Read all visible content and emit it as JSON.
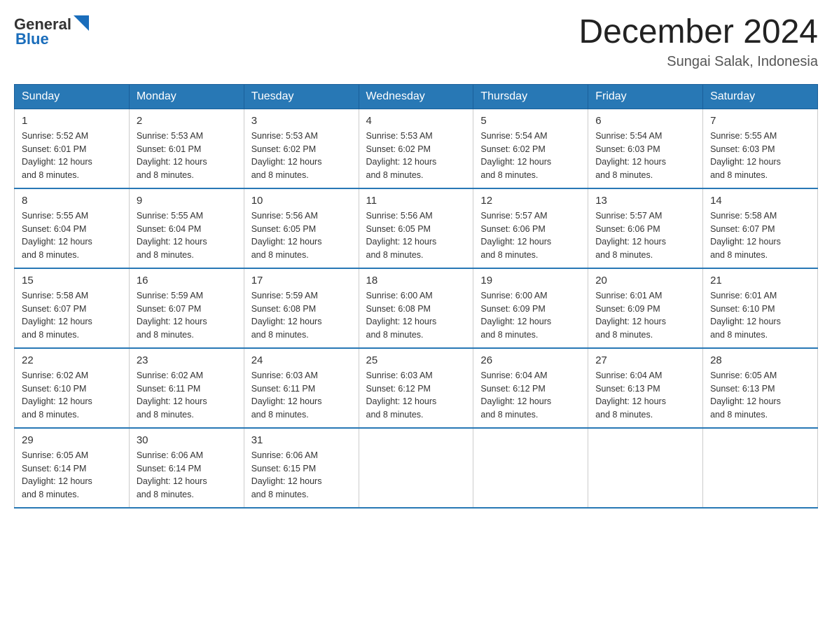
{
  "header": {
    "logo": {
      "general": "General",
      "blue": "Blue"
    },
    "title": "December 2024",
    "location": "Sungai Salak, Indonesia"
  },
  "weekdays": [
    "Sunday",
    "Monday",
    "Tuesday",
    "Wednesday",
    "Thursday",
    "Friday",
    "Saturday"
  ],
  "weeks": [
    [
      {
        "day": "1",
        "sunrise": "5:52 AM",
        "sunset": "6:01 PM",
        "daylight": "12 hours and 8 minutes."
      },
      {
        "day": "2",
        "sunrise": "5:53 AM",
        "sunset": "6:01 PM",
        "daylight": "12 hours and 8 minutes."
      },
      {
        "day": "3",
        "sunrise": "5:53 AM",
        "sunset": "6:02 PM",
        "daylight": "12 hours and 8 minutes."
      },
      {
        "day": "4",
        "sunrise": "5:53 AM",
        "sunset": "6:02 PM",
        "daylight": "12 hours and 8 minutes."
      },
      {
        "day": "5",
        "sunrise": "5:54 AM",
        "sunset": "6:02 PM",
        "daylight": "12 hours and 8 minutes."
      },
      {
        "day": "6",
        "sunrise": "5:54 AM",
        "sunset": "6:03 PM",
        "daylight": "12 hours and 8 minutes."
      },
      {
        "day": "7",
        "sunrise": "5:55 AM",
        "sunset": "6:03 PM",
        "daylight": "12 hours and 8 minutes."
      }
    ],
    [
      {
        "day": "8",
        "sunrise": "5:55 AM",
        "sunset": "6:04 PM",
        "daylight": "12 hours and 8 minutes."
      },
      {
        "day": "9",
        "sunrise": "5:55 AM",
        "sunset": "6:04 PM",
        "daylight": "12 hours and 8 minutes."
      },
      {
        "day": "10",
        "sunrise": "5:56 AM",
        "sunset": "6:05 PM",
        "daylight": "12 hours and 8 minutes."
      },
      {
        "day": "11",
        "sunrise": "5:56 AM",
        "sunset": "6:05 PM",
        "daylight": "12 hours and 8 minutes."
      },
      {
        "day": "12",
        "sunrise": "5:57 AM",
        "sunset": "6:06 PM",
        "daylight": "12 hours and 8 minutes."
      },
      {
        "day": "13",
        "sunrise": "5:57 AM",
        "sunset": "6:06 PM",
        "daylight": "12 hours and 8 minutes."
      },
      {
        "day": "14",
        "sunrise": "5:58 AM",
        "sunset": "6:07 PM",
        "daylight": "12 hours and 8 minutes."
      }
    ],
    [
      {
        "day": "15",
        "sunrise": "5:58 AM",
        "sunset": "6:07 PM",
        "daylight": "12 hours and 8 minutes."
      },
      {
        "day": "16",
        "sunrise": "5:59 AM",
        "sunset": "6:07 PM",
        "daylight": "12 hours and 8 minutes."
      },
      {
        "day": "17",
        "sunrise": "5:59 AM",
        "sunset": "6:08 PM",
        "daylight": "12 hours and 8 minutes."
      },
      {
        "day": "18",
        "sunrise": "6:00 AM",
        "sunset": "6:08 PM",
        "daylight": "12 hours and 8 minutes."
      },
      {
        "day": "19",
        "sunrise": "6:00 AM",
        "sunset": "6:09 PM",
        "daylight": "12 hours and 8 minutes."
      },
      {
        "day": "20",
        "sunrise": "6:01 AM",
        "sunset": "6:09 PM",
        "daylight": "12 hours and 8 minutes."
      },
      {
        "day": "21",
        "sunrise": "6:01 AM",
        "sunset": "6:10 PM",
        "daylight": "12 hours and 8 minutes."
      }
    ],
    [
      {
        "day": "22",
        "sunrise": "6:02 AM",
        "sunset": "6:10 PM",
        "daylight": "12 hours and 8 minutes."
      },
      {
        "day": "23",
        "sunrise": "6:02 AM",
        "sunset": "6:11 PM",
        "daylight": "12 hours and 8 minutes."
      },
      {
        "day": "24",
        "sunrise": "6:03 AM",
        "sunset": "6:11 PM",
        "daylight": "12 hours and 8 minutes."
      },
      {
        "day": "25",
        "sunrise": "6:03 AM",
        "sunset": "6:12 PM",
        "daylight": "12 hours and 8 minutes."
      },
      {
        "day": "26",
        "sunrise": "6:04 AM",
        "sunset": "6:12 PM",
        "daylight": "12 hours and 8 minutes."
      },
      {
        "day": "27",
        "sunrise": "6:04 AM",
        "sunset": "6:13 PM",
        "daylight": "12 hours and 8 minutes."
      },
      {
        "day": "28",
        "sunrise": "6:05 AM",
        "sunset": "6:13 PM",
        "daylight": "12 hours and 8 minutes."
      }
    ],
    [
      {
        "day": "29",
        "sunrise": "6:05 AM",
        "sunset": "6:14 PM",
        "daylight": "12 hours and 8 minutes."
      },
      {
        "day": "30",
        "sunrise": "6:06 AM",
        "sunset": "6:14 PM",
        "daylight": "12 hours and 8 minutes."
      },
      {
        "day": "31",
        "sunrise": "6:06 AM",
        "sunset": "6:15 PM",
        "daylight": "12 hours and 8 minutes."
      },
      null,
      null,
      null,
      null
    ]
  ],
  "labels": {
    "sunrise_prefix": "Sunrise: ",
    "sunset_prefix": "Sunset: ",
    "daylight_prefix": "Daylight: "
  }
}
